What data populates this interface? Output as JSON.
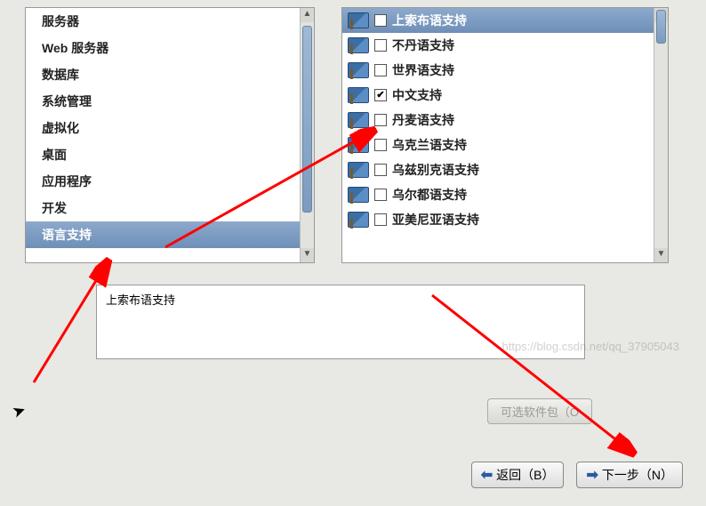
{
  "categories": [
    {
      "label": "服务器",
      "selected": false
    },
    {
      "label": "Web 服务器",
      "selected": false
    },
    {
      "label": "数据库",
      "selected": false
    },
    {
      "label": "系统管理",
      "selected": false
    },
    {
      "label": "虚拟化",
      "selected": false
    },
    {
      "label": "桌面",
      "selected": false
    },
    {
      "label": "应用程序",
      "selected": false
    },
    {
      "label": "开发",
      "selected": false
    },
    {
      "label": "语言支持",
      "selected": true
    }
  ],
  "languages": [
    {
      "label": "上索布语支持",
      "checked": false,
      "selected": true
    },
    {
      "label": "不丹语支持",
      "checked": false,
      "selected": false
    },
    {
      "label": "世界语支持",
      "checked": false,
      "selected": false
    },
    {
      "label": "中文支持",
      "checked": true,
      "selected": false
    },
    {
      "label": "丹麦语支持",
      "checked": false,
      "selected": false
    },
    {
      "label": "乌克兰语支持",
      "checked": false,
      "selected": false
    },
    {
      "label": "乌兹别克语支持",
      "checked": false,
      "selected": false
    },
    {
      "label": "乌尔都语支持",
      "checked": false,
      "selected": false
    },
    {
      "label": "亚美尼亚语支持",
      "checked": false,
      "selected": false
    }
  ],
  "description": "上索布语支持",
  "buttons": {
    "optional": "可选软件包（O",
    "back": "返回（B）",
    "next": "下一步（N）"
  },
  "watermark": "https://blog.csdn.net/qq_37905043"
}
